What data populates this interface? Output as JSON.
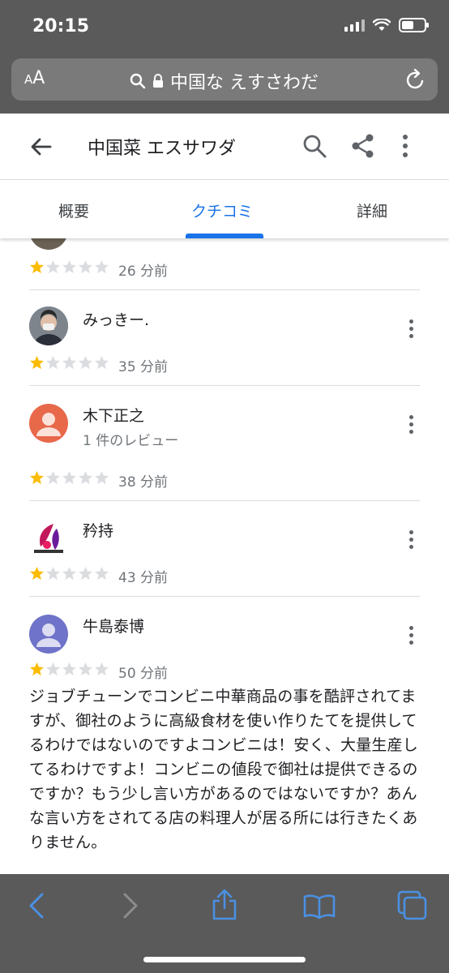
{
  "status": {
    "time": "20:15"
  },
  "browser": {
    "aa_label_small": "A",
    "aa_label_large": "A",
    "url": "中国な えすさわだ"
  },
  "header": {
    "title": "中国菜 エスサワダ"
  },
  "tabs": [
    {
      "label": "概要"
    },
    {
      "label": "クチコミ",
      "active": true
    },
    {
      "label": "詳細"
    }
  ],
  "reviews": [
    {
      "name": "",
      "subtitle": "",
      "rating": 1,
      "time": "26 分前",
      "text": ""
    },
    {
      "name": "みっきー.",
      "subtitle": "",
      "rating": 1,
      "time": "35 分前",
      "text": ""
    },
    {
      "name": "木下正之",
      "subtitle": "1 件のレビュー",
      "rating": 1,
      "time": "38 分前",
      "text": ""
    },
    {
      "name": "矜持",
      "subtitle": "",
      "rating": 1,
      "time": "43 分前",
      "text": ""
    },
    {
      "name": "牛島泰博",
      "subtitle": "",
      "rating": 1,
      "time": "50 分前",
      "text": "ジョブチューンでコンビニ中華商品の事を酷評されてますが、御社のように高級食材を使い作りたてを提供してるわけではないのですよコンビニは！安く、大量生産してるわけですよ！コンビニの値段で御社は提供できるのですか？もう少し言い方があるのではないですか？あんな言い方をされてる店の料理人が居る所には行きたくありません。"
    }
  ],
  "colors": {
    "accent": "#1a73e8",
    "star_filled": "#fbbc04",
    "star_empty": "#dadce0",
    "avatar_orange": "#e8684a",
    "avatar_purple": "#6f73c9"
  }
}
